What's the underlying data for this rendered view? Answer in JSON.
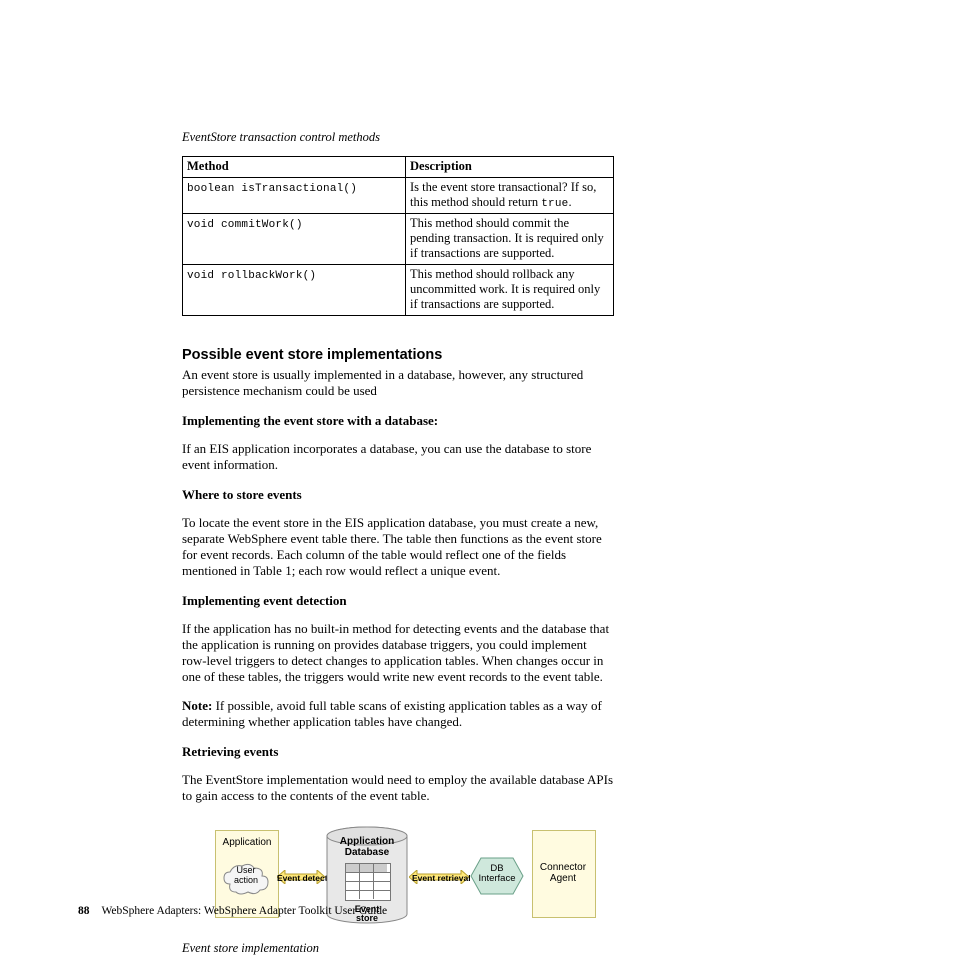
{
  "tableCaption": "EventStore transaction control methods",
  "tableHeaders": {
    "method": "Method",
    "description": "Description"
  },
  "tableRows": [
    {
      "method": "boolean isTransactional()",
      "descPrefix": "Is the event store transactional? If so, this method should return ",
      "descCode": "true",
      "descSuffix": "."
    },
    {
      "method": "void commitWork()",
      "desc": "This method should commit the pending transaction. It is required only if transactions are supported."
    },
    {
      "method": "void rollbackWork()",
      "desc": "This method should rollback any uncommitted work. It is required only if transactions are supported."
    }
  ],
  "sectionHeading": "Possible event store implementations",
  "intro": "An event store is usually implemented in a database, however, any structured persistence mechanism could be used",
  "sub1": "Implementing the event store with a database:",
  "sub1text": "If an EIS application incorporates a database, you can use the database to store event information.",
  "sub2": "Where to store events",
  "sub2text": "To locate the event store in the EIS application database, you must create a new, separate WebSphere event table there. The table then functions as the event store for event records. Each column of the table would reflect one of the fields mentioned in Table 1; each row would reflect a unique event.",
  "sub3": "Implementing event detection",
  "sub3text": "If the application has no built-in method for detecting events and the database that the application is running on provides database triggers, you could implement row-level triggers to detect changes to application tables. When changes occur in one of these tables, the triggers would write new event records to the event table.",
  "noteLabel": "Note:",
  "noteText": " If possible, avoid full table scans of existing application tables as a way of determining whether application tables have changed.",
  "sub4": "Retrieving events",
  "sub4text": "The EventStore implementation would need to employ the available database APIs to gain access to the contents of the event table.",
  "figureCaption": "Event store implementation",
  "diagram": {
    "application": "Application",
    "userAction1": "User",
    "userAction2": "action",
    "eventDetection": "Event detection",
    "appDb1": "Application",
    "appDb2": "Database",
    "eventStore1": "Event",
    "eventStore2": "store",
    "eventRetrieval": "Event retrieval",
    "dbInterface1": "DB",
    "dbInterface2": "Interface",
    "connector1": "Connector",
    "connector2": "Agent"
  },
  "footer": {
    "page": "88",
    "text": "WebSphere Adapters: WebSphere Adapter Toolkit User Guide"
  }
}
